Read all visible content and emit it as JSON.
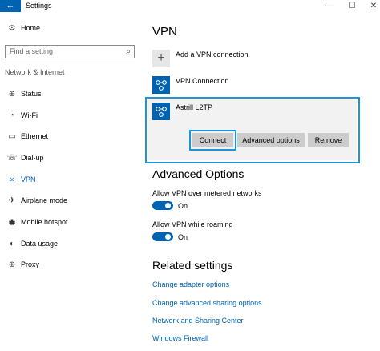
{
  "titlebar": {
    "back_icon": "back-arrow-icon",
    "title": "Settings",
    "min_symbol": "—",
    "max_symbol": "☐",
    "close_symbol": "✕"
  },
  "sidebar": {
    "home": {
      "icon": "gear-icon",
      "label": "Home"
    },
    "search": {
      "placeholder": "Find a setting",
      "icon": "search-icon"
    },
    "section": "Network & Internet",
    "items": [
      {
        "label": "Status",
        "icon": "globe-icon",
        "active": false
      },
      {
        "label": "Wi-Fi",
        "icon": "wifi-icon",
        "active": false
      },
      {
        "label": "Ethernet",
        "icon": "ethernet-icon",
        "active": false
      },
      {
        "label": "Dial-up",
        "icon": "dialup-icon",
        "active": false
      },
      {
        "label": "VPN",
        "icon": "vpn-icon",
        "active": true
      },
      {
        "label": "Airplane mode",
        "icon": "airplane-icon",
        "active": false
      },
      {
        "label": "Mobile hotspot",
        "icon": "hotspot-icon",
        "active": false
      },
      {
        "label": "Data usage",
        "icon": "data-usage-icon",
        "active": false
      },
      {
        "label": "Proxy",
        "icon": "globe-icon",
        "active": false
      }
    ]
  },
  "main": {
    "title": "VPN",
    "add_label": "Add a VPN connection",
    "connections": [
      {
        "name": "VPN Connection"
      },
      {
        "name": "Astrill L2TP",
        "selected": true
      }
    ],
    "buttons": {
      "connect": "Connect",
      "advanced": "Advanced options",
      "remove": "Remove"
    },
    "advanced_title": "Advanced Options",
    "options": [
      {
        "label": "Allow VPN over metered networks",
        "state": "On"
      },
      {
        "label": "Allow VPN while roaming",
        "state": "On"
      }
    ],
    "related_title": "Related settings",
    "links": [
      "Change adapter options",
      "Change advanced sharing options",
      "Network and Sharing Center",
      "Windows Firewall"
    ]
  },
  "colors": {
    "accent": "#0063b1",
    "highlight": "#1a95d8",
    "button_bg": "#cccccc"
  }
}
